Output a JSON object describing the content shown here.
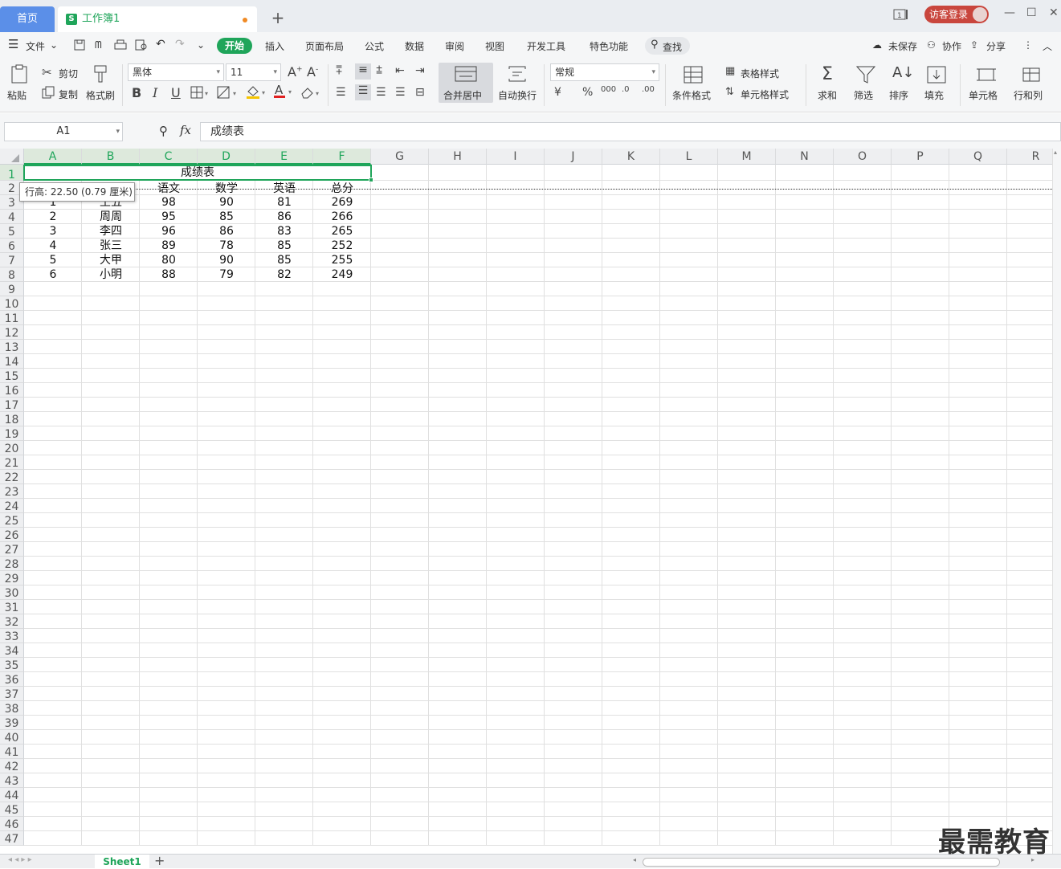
{
  "titlebar": {
    "home_tab": "首页",
    "workbook_tab": "工作簿1",
    "workbook_icon": "S",
    "new_tab": "+",
    "login_button": "访客登录",
    "window_controls": [
      "—",
      "☐",
      "✕"
    ]
  },
  "menu": {
    "file": "文件",
    "items": [
      "开始",
      "插入",
      "页面布局",
      "公式",
      "数据",
      "审阅",
      "视图",
      "开发工具",
      "特色功能",
      "查找"
    ],
    "right": {
      "unsaved": "未保存",
      "collab": "协作",
      "share": "分享"
    }
  },
  "toolbar": {
    "paste": "粘贴",
    "cut": "剪切",
    "copy": "复制",
    "format_painter": "格式刷",
    "font_name": "黑体",
    "font_size": "11",
    "merge_center": "合并居中",
    "wrap_text": "自动换行",
    "number_format": "常规",
    "cond_format": "条件格式",
    "table_style": "表格样式",
    "cell_style": "单元格样式",
    "sum": "求和",
    "filter": "筛选",
    "sort": "排序",
    "fill": "填充",
    "cell": "单元格",
    "row_col": "行和列"
  },
  "formula_bar": {
    "name_box": "A1",
    "fx": "fx",
    "content": "成绩表"
  },
  "grid": {
    "columns": [
      "A",
      "B",
      "C",
      "D",
      "E",
      "F",
      "G",
      "H",
      "I",
      "J",
      "K",
      "L",
      "M",
      "N",
      "O",
      "P",
      "Q",
      "R"
    ],
    "active_columns": [
      "A",
      "B",
      "C",
      "D",
      "E",
      "F"
    ],
    "row_count": 47,
    "title": "成绩表",
    "headers": [
      "",
      "",
      "语文",
      "数学",
      "英语",
      "总分"
    ],
    "rows": [
      [
        "1",
        "王五",
        "98",
        "90",
        "81",
        "269"
      ],
      [
        "2",
        "周周",
        "95",
        "85",
        "86",
        "266"
      ],
      [
        "3",
        "李四",
        "96",
        "86",
        "83",
        "265"
      ],
      [
        "4",
        "张三",
        "89",
        "78",
        "85",
        "252"
      ],
      [
        "5",
        "大甲",
        "80",
        "90",
        "85",
        "255"
      ],
      [
        "6",
        "小明",
        "88",
        "79",
        "82",
        "249"
      ]
    ],
    "tooltip": "行高: 22.50 (0.79 厘米)"
  },
  "sheets": {
    "active": "Sheet1",
    "add": "+"
  },
  "watermark": "最需教育"
}
